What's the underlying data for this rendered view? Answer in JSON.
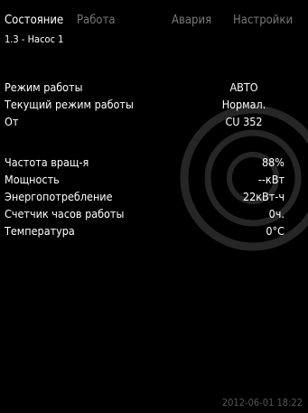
{
  "tabs": [
    {
      "label": "Состояние",
      "active": true
    },
    {
      "label": "Работа",
      "active": false
    },
    {
      "label": "Авария",
      "active": false
    },
    {
      "label": "Настройки",
      "active": false
    }
  ],
  "breadcrumb": "1.3 - Насос 1",
  "mode_section": [
    {
      "label": "Режим работы",
      "value": "АВТО"
    },
    {
      "label": "Текущий режим работы",
      "value": "Нормал."
    },
    {
      "label": "От",
      "value": "CU 352"
    }
  ],
  "measurements": [
    {
      "label": "Частота вращ-я",
      "value": "88%"
    },
    {
      "label": "Мощность",
      "value": "--кВт"
    },
    {
      "label": "Энергопотребление",
      "value": "22кВт-ч"
    },
    {
      "label": "Счетчик часов работы",
      "value": "0ч."
    },
    {
      "label": "Температура",
      "value": "0°C"
    }
  ],
  "timestamp": "2012-06-01 18:22",
  "colors": {
    "background": "#000000",
    "text": "#ffffff",
    "inactive_tab": "#777777",
    "decoration": "#2a2a2a"
  }
}
